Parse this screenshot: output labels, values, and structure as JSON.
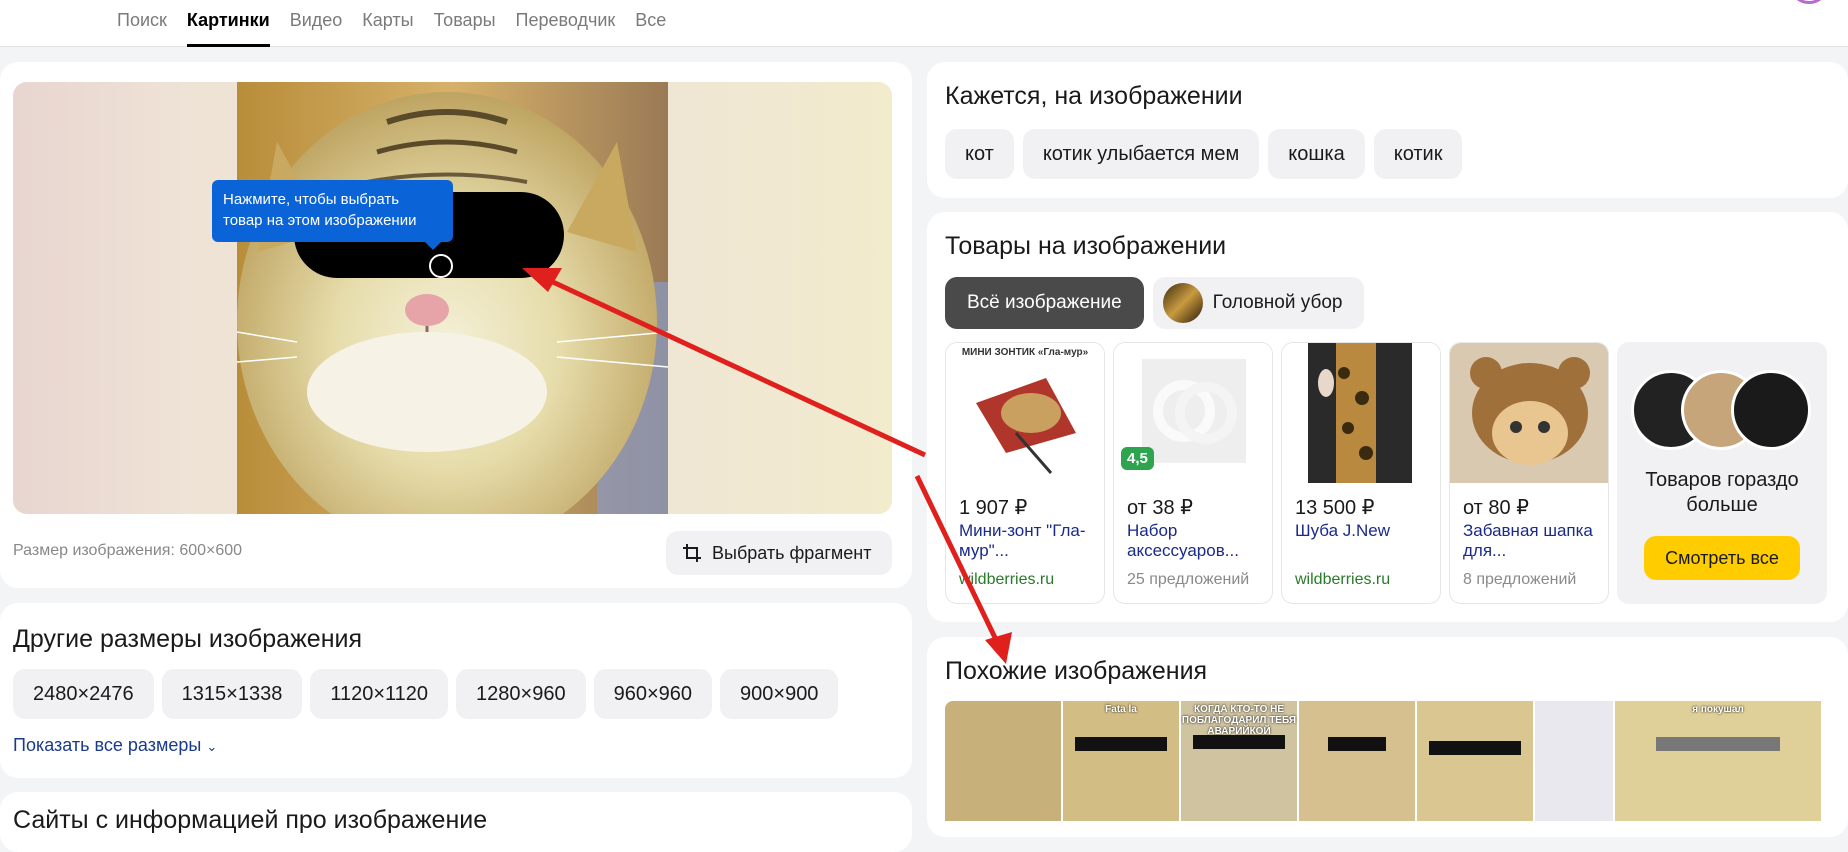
{
  "nav": {
    "tabs": [
      "Поиск",
      "Картинки",
      "Видео",
      "Карты",
      "Товары",
      "Переводчик",
      "Все"
    ],
    "active": "Картинки"
  },
  "viewer": {
    "tooltip": "Нажмите, чтобы выбрать товар на этом изображении",
    "size_text": "Размер изображения: 600×600",
    "fragment_button": "Выбрать фрагмент"
  },
  "other_sizes": {
    "title": "Другие размеры изображения",
    "sizes": [
      "2480×2476",
      "1315×1338",
      "1120×1120",
      "1280×960",
      "960×960",
      "900×900"
    ],
    "show_all": "Показать все размеры"
  },
  "sites": {
    "title": "Сайты с информацией про изображение"
  },
  "seems": {
    "title": "Кажется, на изображении",
    "tags": [
      "кот",
      "котик улыбается мем",
      "кошка",
      "котик"
    ]
  },
  "goods": {
    "title": "Товары на изображении",
    "tabs": [
      "Всё изображение",
      "Головной убор"
    ],
    "products": [
      {
        "price": "1 907 ₽",
        "name": "Мини-зонт \"Гла-мур\"...",
        "shop": "wildberries.ru",
        "img_caption": "МИНИ ЗОНТИК «Гла-мур»"
      },
      {
        "price": "от 38 ₽",
        "name": "Набор аксессуаров...",
        "offers": "25 предложений",
        "rating": "4,5"
      },
      {
        "price": "13 500 ₽",
        "name": "Шуба J.New",
        "shop": "wildberries.ru"
      },
      {
        "price": "от 80 ₽",
        "name": "Забавная шапка для...",
        "offers": "8 предложений"
      }
    ],
    "more_text": "Товаров гораздо больше",
    "more_button": "Смотреть все"
  },
  "similar": {
    "title": "Похожие изображения",
    "captions": [
      "",
      "Fata la",
      "КОГДА КТО-ТО НЕ ПОБЛАГОДАРИЛ ТЕБЯ АВАРИЙКОЙ",
      "",
      "",
      "",
      "я покушал"
    ]
  }
}
